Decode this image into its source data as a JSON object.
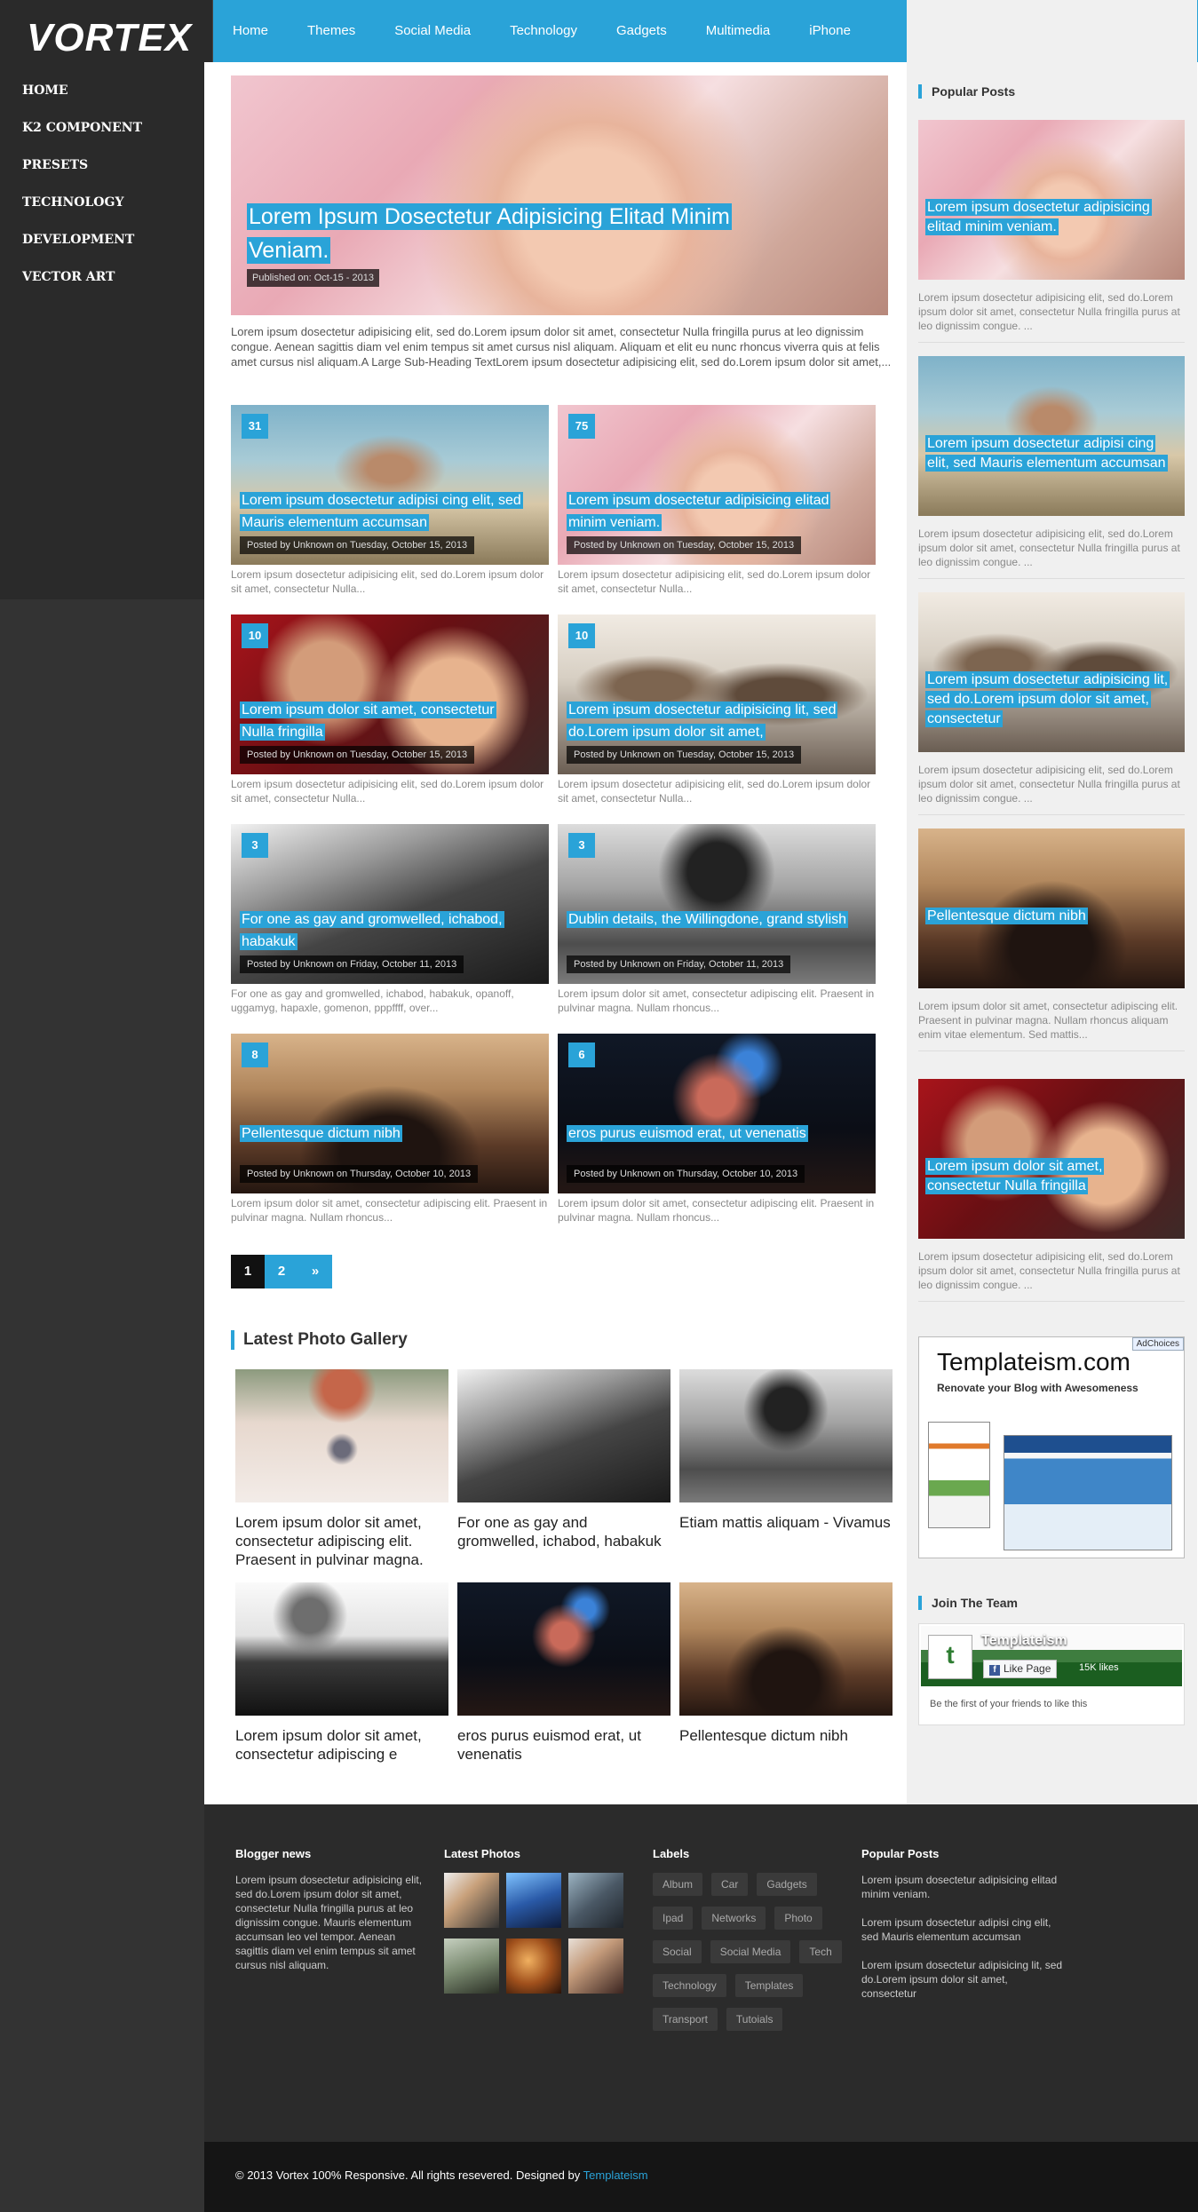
{
  "logo": "VORTEX",
  "left_nav": [
    "HOME",
    "K2 COMPONENT",
    "PRESETS",
    "TECHNOLOGY",
    "DEVELOPMENT",
    "VECTOR ART"
  ],
  "top_nav": [
    "Home",
    "Themes",
    "Social Media",
    "Technology",
    "Gadgets",
    "Multimedia",
    "iPhone"
  ],
  "social_icons": [
    "twitter-icon",
    "facebook-icon",
    "pinterest-icon",
    "rss-icon"
  ],
  "featured": {
    "title": "Lorem Ipsum Dosectetur Adipisicing Elitad Minim Veniam.",
    "published": "Published on: Oct-15 - 2013",
    "text": "Lorem ipsum dosectetur adipisicing elit, sed do.Lorem ipsum dolor sit amet, consectetur Nulla fringilla purus at leo dignissim congue. Aenean sagittis diam vel enim tempus sit amet cursus nisl aliquam. Aliquam et elit eu nunc rhoncus viverra quis at felis amet cursus nisl aliquam.A Large Sub-Heading TextLorem ipsum dosectetur adipisicing elit, sed do.Lorem ipsum dolor sit amet,..."
  },
  "posts": [
    {
      "count": "31",
      "title": "Lorem ipsum dosectetur adipisi cing elit, sed Mauris elementum accumsan",
      "meta": "Posted by Unknown on Tuesday, October 15, 2013",
      "excerpt": "Lorem ipsum dosectetur adipisicing elit, sed do.Lorem ipsum dolor sit amet, consectetur Nulla..."
    },
    {
      "count": "75",
      "title": "Lorem ipsum dosectetur adipisicing elitad minim veniam.",
      "meta": "Posted by Unknown on Tuesday, October 15, 2013",
      "excerpt": "Lorem ipsum dosectetur adipisicing elit, sed do.Lorem ipsum dolor sit amet, consectetur Nulla..."
    },
    {
      "count": "10",
      "title": "Lorem ipsum dolor sit amet, consectetur Nulla fringilla",
      "meta": "Posted by Unknown on Tuesday, October 15, 2013",
      "excerpt": "Lorem ipsum dosectetur adipisicing elit, sed do.Lorem ipsum dolor sit amet, consectetur Nulla..."
    },
    {
      "count": "10",
      "title": "Lorem ipsum dosectetur adipisicing lit, sed do.Lorem ipsum dolor sit amet,",
      "meta": "Posted by Unknown on Tuesday, October 15, 2013",
      "excerpt": "Lorem ipsum dosectetur adipisicing elit, sed do.Lorem ipsum dolor sit amet, consectetur Nulla..."
    },
    {
      "count": "3",
      "title": "For one as gay and gromwelled, ichabod, habakuk",
      "meta": "Posted by Unknown on Friday, October 11, 2013",
      "excerpt": "For one as gay and gromwelled, ichabod, habakuk, opanoff, uggamyg, hapaxle, gomenon, pppffff, over..."
    },
    {
      "count": "3",
      "title": "Dublin details, the Willingdone, grand stylish",
      "meta": "Posted by Unknown on Friday, October 11, 2013",
      "excerpt": "Lorem ipsum dolor sit amet, consectetur adipiscing elit. Praesent in pulvinar magna. Nullam rhoncus..."
    },
    {
      "count": "8",
      "title": "Pellentesque dictum nibh",
      "meta": "Posted by Unknown on Thursday, October 10, 2013",
      "excerpt": "Lorem ipsum dolor sit amet, consectetur adipiscing elit. Praesent in pulvinar magna. Nullam rhoncus..."
    },
    {
      "count": "6",
      "title": "eros purus euismod erat, ut venenatis",
      "meta": "Posted by Unknown on Thursday, October 10, 2013",
      "excerpt": "Lorem ipsum dolor sit amet, consectetur adipiscing elit. Praesent in pulvinar magna. Nullam rhoncus..."
    }
  ],
  "pager": [
    "1",
    "2",
    "»"
  ],
  "gallery": {
    "title": "Latest Photo Gallery",
    "items": [
      "Lorem ipsum dolor sit amet, consectetur adipiscing elit. Praesent in pulvinar magna.",
      "For one as gay and gromwelled, ichabod, habakuk",
      "Etiam mattis aliquam - Vivamus",
      "Lorem ipsum dolor sit amet, consectetur adipiscing e",
      "eros purus euismod erat, ut venenatis",
      "Pellentesque dictum nibh"
    ]
  },
  "sidebar": {
    "popular_title": "Popular Posts",
    "popular": [
      {
        "title": "Lorem ipsum dosectetur adipisicing elitad minim veniam.",
        "excerpt": "Lorem ipsum dosectetur adipisicing elit, sed do.Lorem ipsum dolor sit amet, consectetur Nulla fringilla purus at leo dignissim congue. ..."
      },
      {
        "title": "Lorem ipsum dosectetur adipisi cing elit, sed Mauris elementum accumsan",
        "excerpt": "Lorem ipsum dosectetur adipisicing elit, sed do.Lorem ipsum dolor sit amet, consectetur Nulla fringilla purus at leo dignissim congue. ..."
      },
      {
        "title": "Lorem ipsum dosectetur adipisicing lit, sed do.Lorem ipsum dolor sit amet, consectetur",
        "excerpt": "Lorem ipsum dosectetur adipisicing elit, sed do.Lorem ipsum dolor sit amet, consectetur Nulla fringilla purus at leo dignissim congue. ..."
      },
      {
        "title": "Pellentesque dictum nibh",
        "excerpt": "Lorem ipsum dolor sit amet, consectetur adipiscing elit. Praesent in pulvinar magna. Nullam rhoncus aliquam enim vitae elementum. Sed mattis..."
      },
      {
        "title": "Lorem ipsum dolor sit amet, consectetur Nulla fringilla",
        "excerpt": "Lorem ipsum dosectetur adipisicing elit, sed do.Lorem ipsum dolor sit amet, consectetur Nulla fringilla purus at leo dignissim congue. ..."
      }
    ],
    "ad": {
      "choices": "AdChoices",
      "title": "Templateism.com",
      "subtitle": "Renovate your Blog with Awesomeness"
    },
    "join_title": "Join The Team",
    "fb": {
      "name": "Templateism",
      "like": "Like Page",
      "logo": "t",
      "count": "15K likes",
      "friends": "Be the first of your friends to like this"
    }
  },
  "footer": {
    "blogger_title": "Blogger news",
    "blogger_text": "Lorem ipsum dosectetur adipisicing elit, sed do.Lorem ipsum dolor sit amet, consectetur Nulla fringilla purus at leo dignissim congue. Mauris elementum accumsan leo vel tempor. Aenean sagittis diam vel enim tempus sit amet cursus nisl aliquam.",
    "photos_title": "Latest Photos",
    "labels_title": "Labels",
    "labels": [
      "Album",
      "Car",
      "Gadgets",
      "Ipad",
      "Networks",
      "Photo",
      "Social",
      "Social Media",
      "Tech",
      "Technology",
      "Templates",
      "Transport",
      "Tutoials"
    ],
    "popular_title": "Popular Posts",
    "popular": [
      "Lorem ipsum dosectetur adipisicing elitad minim veniam.",
      "Lorem ipsum dosectetur adipisi cing elit, sed Mauris elementum accumsan",
      "Lorem ipsum dosectetur adipisicing lit, sed do.Lorem ipsum dolor sit amet, consectetur"
    ]
  },
  "copyright": "© 2013 Vortex 100% Responsive. All rights resevered. Designed by",
  "copyright_link": "Templateism",
  "colors": {
    "accent": "#2aa3d8",
    "dark": "#2b2b2b"
  }
}
